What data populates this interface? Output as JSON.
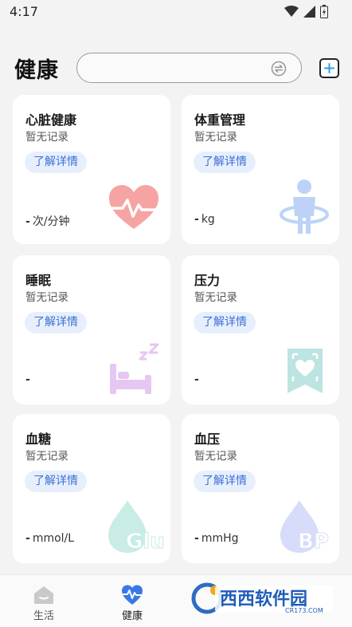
{
  "status": {
    "time": "4:17"
  },
  "header": {
    "title": "健康",
    "search_placeholder": ""
  },
  "cards": [
    {
      "title": "心脏健康",
      "subtitle": "暂无记录",
      "button": "了解详情",
      "value": "-",
      "unit": "次/分钟",
      "icon": "heart-rate-icon"
    },
    {
      "title": "体重管理",
      "subtitle": "暂无记录",
      "button": "了解详情",
      "value": "-",
      "unit": "kg",
      "icon": "weight-body-icon"
    },
    {
      "title": "睡眠",
      "subtitle": "暂无记录",
      "button": "了解详情",
      "value": "-",
      "unit": "",
      "icon": "bed-sleep-icon"
    },
    {
      "title": "压力",
      "subtitle": "暂无记录",
      "button": "了解详情",
      "value": "-",
      "unit": "",
      "icon": "stress-heart-frame-icon"
    },
    {
      "title": "血糖",
      "subtitle": "暂无记录",
      "button": "了解详情",
      "value": "-",
      "unit": "mmol/L",
      "icon": "glucose-drop-icon"
    },
    {
      "title": "血压",
      "subtitle": "暂无记录",
      "button": "了解详情",
      "value": "-",
      "unit": "mmHg",
      "icon": "blood-pressure-drop-icon"
    }
  ],
  "icon_text": {
    "glu": "Glu",
    "bp": "BP"
  },
  "nav": [
    {
      "label": "生活",
      "icon": "life-icon",
      "active": false
    },
    {
      "label": "健康",
      "icon": "heart-pulse-icon",
      "active": true
    }
  ],
  "watermark": {
    "text": "西西软件园",
    "sub": "CR173.COM"
  },
  "colors": {
    "accent": "#3b6fd6",
    "button_bg": "#e7effd",
    "heart": "#f6a3a3",
    "weight": "#bcd3f7",
    "sleep": "#e5c7f1",
    "stress": "#bde4e1",
    "glucose": "#c9ece6",
    "bp": "#d7dcfa"
  }
}
